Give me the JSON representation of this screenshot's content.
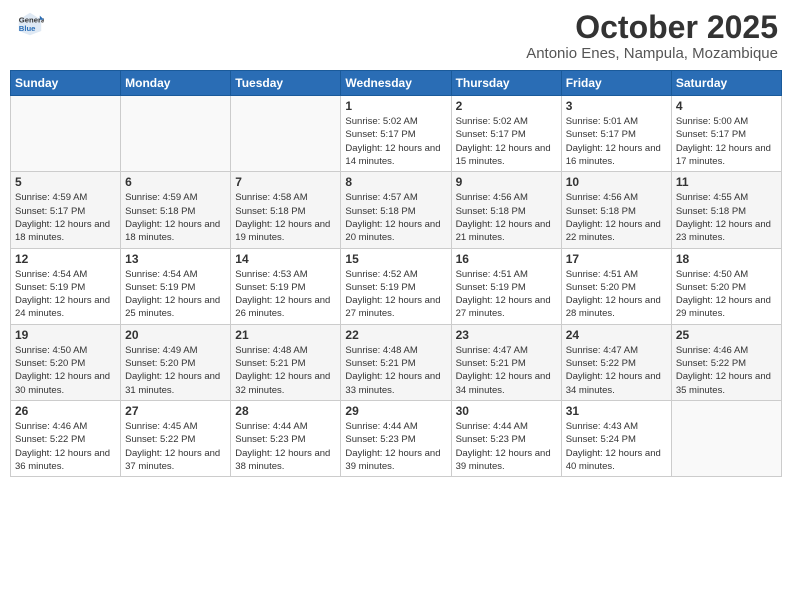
{
  "logo": {
    "line1": "General",
    "line2": "Blue"
  },
  "title": "October 2025",
  "subtitle": "Antonio Enes, Nampula, Mozambique",
  "weekdays": [
    "Sunday",
    "Monday",
    "Tuesday",
    "Wednesday",
    "Thursday",
    "Friday",
    "Saturday"
  ],
  "weeks": [
    [
      {
        "day": "",
        "info": ""
      },
      {
        "day": "",
        "info": ""
      },
      {
        "day": "",
        "info": ""
      },
      {
        "day": "1",
        "info": "Sunrise: 5:02 AM\nSunset: 5:17 PM\nDaylight: 12 hours\nand 14 minutes."
      },
      {
        "day": "2",
        "info": "Sunrise: 5:02 AM\nSunset: 5:17 PM\nDaylight: 12 hours\nand 15 minutes."
      },
      {
        "day": "3",
        "info": "Sunrise: 5:01 AM\nSunset: 5:17 PM\nDaylight: 12 hours\nand 16 minutes."
      },
      {
        "day": "4",
        "info": "Sunrise: 5:00 AM\nSunset: 5:17 PM\nDaylight: 12 hours\nand 17 minutes."
      }
    ],
    [
      {
        "day": "5",
        "info": "Sunrise: 4:59 AM\nSunset: 5:17 PM\nDaylight: 12 hours\nand 18 minutes."
      },
      {
        "day": "6",
        "info": "Sunrise: 4:59 AM\nSunset: 5:18 PM\nDaylight: 12 hours\nand 18 minutes."
      },
      {
        "day": "7",
        "info": "Sunrise: 4:58 AM\nSunset: 5:18 PM\nDaylight: 12 hours\nand 19 minutes."
      },
      {
        "day": "8",
        "info": "Sunrise: 4:57 AM\nSunset: 5:18 PM\nDaylight: 12 hours\nand 20 minutes."
      },
      {
        "day": "9",
        "info": "Sunrise: 4:56 AM\nSunset: 5:18 PM\nDaylight: 12 hours\nand 21 minutes."
      },
      {
        "day": "10",
        "info": "Sunrise: 4:56 AM\nSunset: 5:18 PM\nDaylight: 12 hours\nand 22 minutes."
      },
      {
        "day": "11",
        "info": "Sunrise: 4:55 AM\nSunset: 5:18 PM\nDaylight: 12 hours\nand 23 minutes."
      }
    ],
    [
      {
        "day": "12",
        "info": "Sunrise: 4:54 AM\nSunset: 5:19 PM\nDaylight: 12 hours\nand 24 minutes."
      },
      {
        "day": "13",
        "info": "Sunrise: 4:54 AM\nSunset: 5:19 PM\nDaylight: 12 hours\nand 25 minutes."
      },
      {
        "day": "14",
        "info": "Sunrise: 4:53 AM\nSunset: 5:19 PM\nDaylight: 12 hours\nand 26 minutes."
      },
      {
        "day": "15",
        "info": "Sunrise: 4:52 AM\nSunset: 5:19 PM\nDaylight: 12 hours\nand 27 minutes."
      },
      {
        "day": "16",
        "info": "Sunrise: 4:51 AM\nSunset: 5:19 PM\nDaylight: 12 hours\nand 27 minutes."
      },
      {
        "day": "17",
        "info": "Sunrise: 4:51 AM\nSunset: 5:20 PM\nDaylight: 12 hours\nand 28 minutes."
      },
      {
        "day": "18",
        "info": "Sunrise: 4:50 AM\nSunset: 5:20 PM\nDaylight: 12 hours\nand 29 minutes."
      }
    ],
    [
      {
        "day": "19",
        "info": "Sunrise: 4:50 AM\nSunset: 5:20 PM\nDaylight: 12 hours\nand 30 minutes."
      },
      {
        "day": "20",
        "info": "Sunrise: 4:49 AM\nSunset: 5:20 PM\nDaylight: 12 hours\nand 31 minutes."
      },
      {
        "day": "21",
        "info": "Sunrise: 4:48 AM\nSunset: 5:21 PM\nDaylight: 12 hours\nand 32 minutes."
      },
      {
        "day": "22",
        "info": "Sunrise: 4:48 AM\nSunset: 5:21 PM\nDaylight: 12 hours\nand 33 minutes."
      },
      {
        "day": "23",
        "info": "Sunrise: 4:47 AM\nSunset: 5:21 PM\nDaylight: 12 hours\nand 34 minutes."
      },
      {
        "day": "24",
        "info": "Sunrise: 4:47 AM\nSunset: 5:22 PM\nDaylight: 12 hours\nand 34 minutes."
      },
      {
        "day": "25",
        "info": "Sunrise: 4:46 AM\nSunset: 5:22 PM\nDaylight: 12 hours\nand 35 minutes."
      }
    ],
    [
      {
        "day": "26",
        "info": "Sunrise: 4:46 AM\nSunset: 5:22 PM\nDaylight: 12 hours\nand 36 minutes."
      },
      {
        "day": "27",
        "info": "Sunrise: 4:45 AM\nSunset: 5:22 PM\nDaylight: 12 hours\nand 37 minutes."
      },
      {
        "day": "28",
        "info": "Sunrise: 4:44 AM\nSunset: 5:23 PM\nDaylight: 12 hours\nand 38 minutes."
      },
      {
        "day": "29",
        "info": "Sunrise: 4:44 AM\nSunset: 5:23 PM\nDaylight: 12 hours\nand 39 minutes."
      },
      {
        "day": "30",
        "info": "Sunrise: 4:44 AM\nSunset: 5:23 PM\nDaylight: 12 hours\nand 39 minutes."
      },
      {
        "day": "31",
        "info": "Sunrise: 4:43 AM\nSunset: 5:24 PM\nDaylight: 12 hours\nand 40 minutes."
      },
      {
        "day": "",
        "info": ""
      }
    ]
  ]
}
